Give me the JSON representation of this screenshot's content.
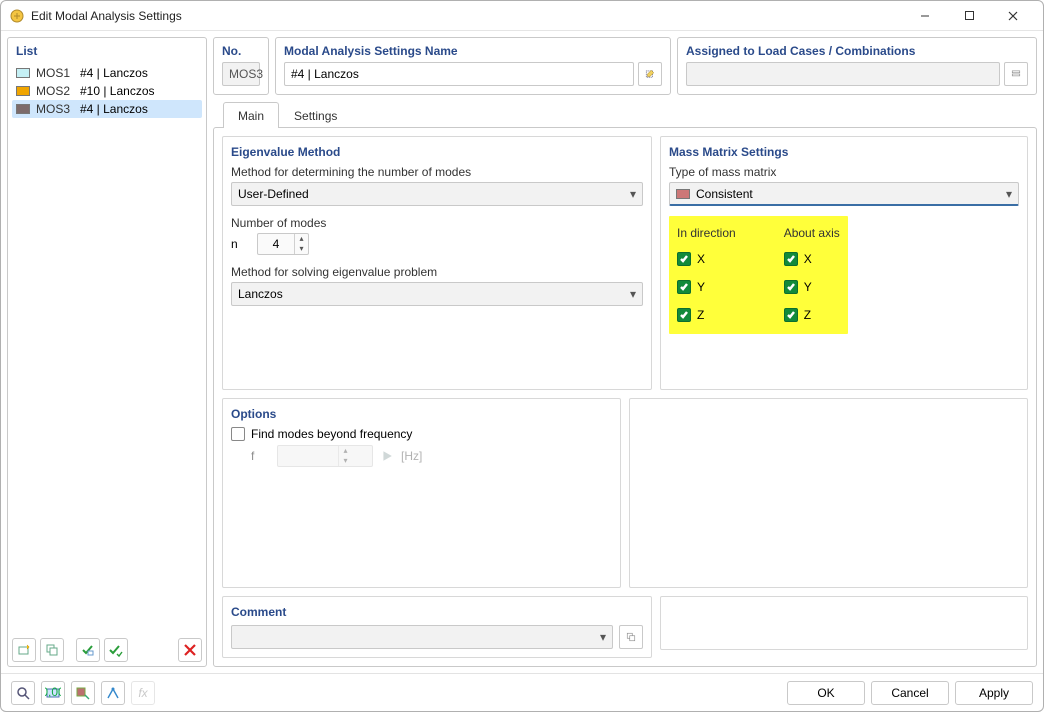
{
  "window": {
    "title": "Edit Modal Analysis Settings"
  },
  "list": {
    "header": "List",
    "items": [
      {
        "code": "MOS1",
        "label": "#4 | Lanczos",
        "color": "#c5f0f5",
        "selected": false
      },
      {
        "code": "MOS2",
        "label": "#10 | Lanczos",
        "color": "#f0a500",
        "selected": false
      },
      {
        "code": "MOS3",
        "label": "#4 | Lanczos",
        "color": "#7d6b6b",
        "selected": true
      }
    ]
  },
  "no": {
    "header": "No.",
    "value": "MOS3"
  },
  "name": {
    "header": "Modal Analysis Settings Name",
    "value": "#4 | Lanczos"
  },
  "assigned": {
    "header": "Assigned to Load Cases / Combinations",
    "value": ""
  },
  "tabs": {
    "main": "Main",
    "settings": "Settings",
    "active": "main"
  },
  "eigen": {
    "title": "Eigenvalue Method",
    "method_modes_label": "Method for determining the number of modes",
    "method_modes_value": "User-Defined",
    "num_modes_label": "Number of modes",
    "num_modes_sym": "n",
    "num_modes_value": "4",
    "solve_label": "Method for solving eigenvalue problem",
    "solve_value": "Lanczos"
  },
  "options": {
    "title": "Options",
    "find_modes_label": "Find modes beyond frequency",
    "find_modes_checked": false,
    "freq_sym": "f",
    "freq_value": "",
    "freq_unit": "[Hz]"
  },
  "mass": {
    "title": "Mass Matrix Settings",
    "type_label": "Type of mass matrix",
    "type_value": "Consistent",
    "color": "#bb7070",
    "col1": "In direction",
    "col2": "About axis",
    "axes": [
      "X",
      "Y",
      "Z"
    ],
    "dir_checked": [
      true,
      true,
      true
    ],
    "axis_checked": [
      true,
      true,
      true
    ]
  },
  "comment": {
    "title": "Comment",
    "value": ""
  },
  "footer": {
    "ok": "OK",
    "cancel": "Cancel",
    "apply": "Apply"
  }
}
